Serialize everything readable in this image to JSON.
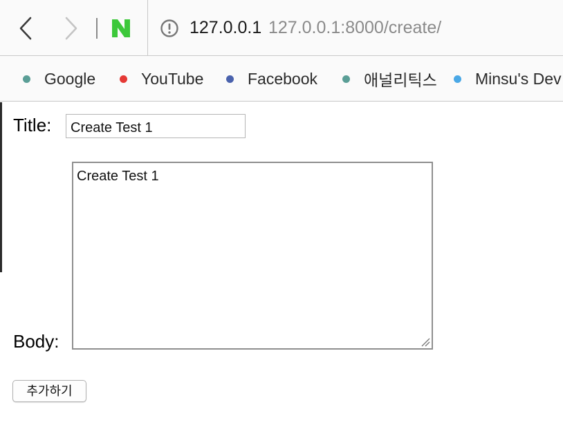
{
  "browser": {
    "url_host": "127.0.0.1",
    "url_full": "127.0.0.1:8000/create/",
    "icons": {
      "back": "chevron-left-icon",
      "forward": "chevron-right-icon",
      "naver": "naver-logo-icon",
      "site_info": "info-circle-icon"
    }
  },
  "bookmarks": [
    {
      "label": "Google",
      "dot_color": "#5a9e96"
    },
    {
      "label": "YouTube",
      "dot_color": "#e53935"
    },
    {
      "label": "Facebook",
      "dot_color": "#4a62ad"
    },
    {
      "label": "애널리틱스",
      "dot_color": "#5a9e96"
    },
    {
      "label": "Minsu's Dev",
      "dot_color": "#4aa8e6"
    }
  ],
  "form": {
    "title_label": "Title:",
    "title_value": "Create Test 1",
    "body_label": "Body:",
    "body_value": "Create Test 1",
    "submit_label": "추가하기"
  },
  "colors": {
    "naver_green": "#3cc83a",
    "toolbar_bg": "#fafafa"
  }
}
